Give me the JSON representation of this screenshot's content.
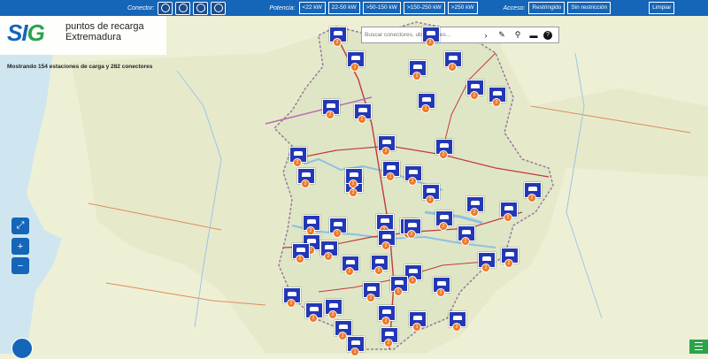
{
  "filter_bar": {
    "connector_label": "Conector:",
    "power_label": "Potencia:",
    "power_options": [
      "<22 kW",
      "22-50 kW",
      ">50-150 kW",
      ">150-250 kW",
      ">250 kW"
    ],
    "access_label": "Acceso:",
    "access_options": [
      "Restringido",
      "Sin restricción"
    ],
    "clear_label": "Limpiar",
    "connector_icons": [
      "connector-type1-icon",
      "connector-type2-icon",
      "connector-ccs-icon",
      "connector-chademo-icon"
    ]
  },
  "logo": {
    "brand_main": "SI",
    "brand_accent": "G",
    "line1": "puntos de recarga",
    "line2": "Extremadura"
  },
  "status": {
    "count_text": "Mostrando 154 estaciones de carga y 282 conectores"
  },
  "search": {
    "placeholder": "Buscar conectores, ubicaciones...",
    "icons": [
      "arrow-right-icon",
      "paintbrush-icon",
      "location-pin-icon",
      "car-icon",
      "help-icon"
    ]
  },
  "zoom": {
    "fullscreen_symbol": "⤢",
    "zoom_in_symbol": "+",
    "zoom_out_symbol": "−"
  },
  "colors": {
    "bar_blue": "#1565b8",
    "marker_blue": "#2338b5",
    "badge_orange": "#f07824",
    "accent_green": "#2ba34a"
  },
  "markers_count_labels": [
    "2",
    "1",
    "2",
    "2",
    "2",
    "1",
    "2",
    "2",
    "2",
    "1",
    "2",
    "2",
    "2",
    "1",
    "2",
    "2",
    "2",
    "2",
    "2",
    "2",
    "2",
    "1",
    "2",
    "2",
    "2",
    "2",
    "2",
    "2",
    "2",
    "2"
  ]
}
